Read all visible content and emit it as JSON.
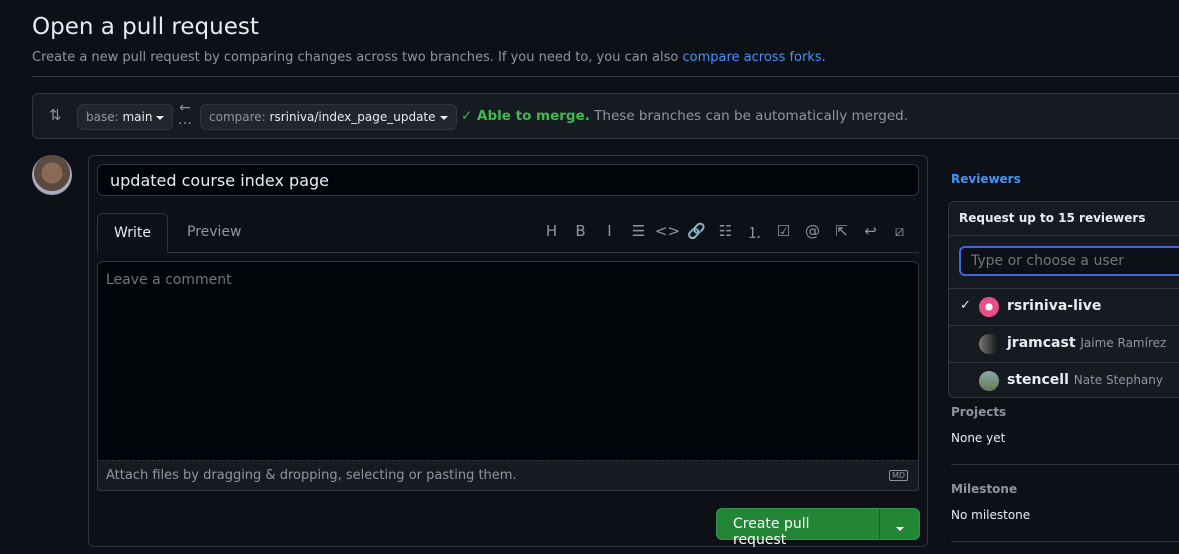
{
  "header": {
    "title": "Open a pull request",
    "subtitle": "Create a new pull request by comparing changes across two branches. If you need to, you can also ",
    "subtitle_link": "compare across forks",
    "subtitle_end": "."
  },
  "branches": {
    "base_label": "base:",
    "base": "main",
    "compare_label": "compare:",
    "compare": "rsriniva/index_page_update",
    "merge_status": "Able to merge.",
    "merge_detail": "These branches can be automatically merged."
  },
  "form": {
    "title_value": "updated course index page",
    "tabs": [
      {
        "label": "Write"
      },
      {
        "label": "Preview"
      }
    ],
    "toolbar": [
      {
        "name": "heading-icon",
        "glyph": "H"
      },
      {
        "name": "bold-icon",
        "glyph": "B"
      },
      {
        "name": "italic-icon",
        "glyph": "I"
      },
      {
        "name": "quote-icon",
        "glyph": "☰"
      },
      {
        "name": "code-icon",
        "glyph": "<>"
      },
      {
        "name": "link-icon",
        "glyph": "🔗"
      },
      {
        "name": "unordered-list-icon",
        "glyph": "☷"
      },
      {
        "name": "ordered-list-icon",
        "glyph": "⒈"
      },
      {
        "name": "task-list-icon",
        "glyph": "☑"
      },
      {
        "name": "mention-icon",
        "glyph": "@"
      },
      {
        "name": "cross-reference-icon",
        "glyph": "⇱"
      },
      {
        "name": "reply-icon",
        "glyph": "↩"
      },
      {
        "name": "slash-commands-icon",
        "glyph": "⧄"
      }
    ],
    "comment_placeholder": "Leave a comment",
    "attach_text": "Attach files by dragging & dropping, selecting or pasting them.",
    "markdown_badge": "MD",
    "submit_label": "Create pull request"
  },
  "sidebar": {
    "reviewers_label": "Reviewers",
    "projects_label": "Projects",
    "projects_value": "None yet",
    "milestone_label": "Milestone",
    "milestone_value": "No milestone"
  },
  "reviewer_popup": {
    "header": "Request up to 15 reviewers",
    "placeholder": "Type or choose a user",
    "users": [
      {
        "login": "rsriniva-live",
        "name": "",
        "selected": true
      },
      {
        "login": "jramcast",
        "name": "Jaime Ramírez",
        "selected": false
      },
      {
        "login": "stencell",
        "name": "Nate Stephany",
        "selected": false
      }
    ]
  },
  "colors": {
    "accent": "#4493f8",
    "success": "#3fb950",
    "button": "#238636",
    "background": "#0d1117"
  }
}
